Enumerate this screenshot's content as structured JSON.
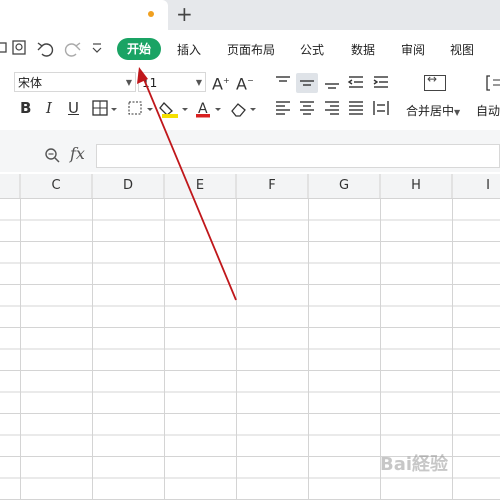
{
  "tabbar": {
    "new_tab_icon": "+"
  },
  "quick_access": {
    "icons": [
      "print-icon",
      "print-preview-icon",
      "undo-icon",
      "redo-icon",
      "more-icon"
    ]
  },
  "menu": {
    "start": "开始",
    "insert": "插入",
    "page_layout": "页面布局",
    "formula": "公式",
    "data": "数据",
    "review": "审阅",
    "view": "视图"
  },
  "ribbon": {
    "font_name": "宋体",
    "font_size": "11",
    "bold": "B",
    "italic": "I",
    "underline": "U",
    "merge_center": "合并居中",
    "auto_wrap": "自动"
  },
  "formula_bar": {
    "fx": "fx",
    "value": ""
  },
  "columns": [
    "C",
    "D",
    "E",
    "F",
    "G",
    "H",
    "I"
  ],
  "colors": {
    "accent": "#1aa364",
    "arrow": "#c0171b",
    "tab_dot": "#f0a020"
  },
  "watermark": "Bai経验"
}
